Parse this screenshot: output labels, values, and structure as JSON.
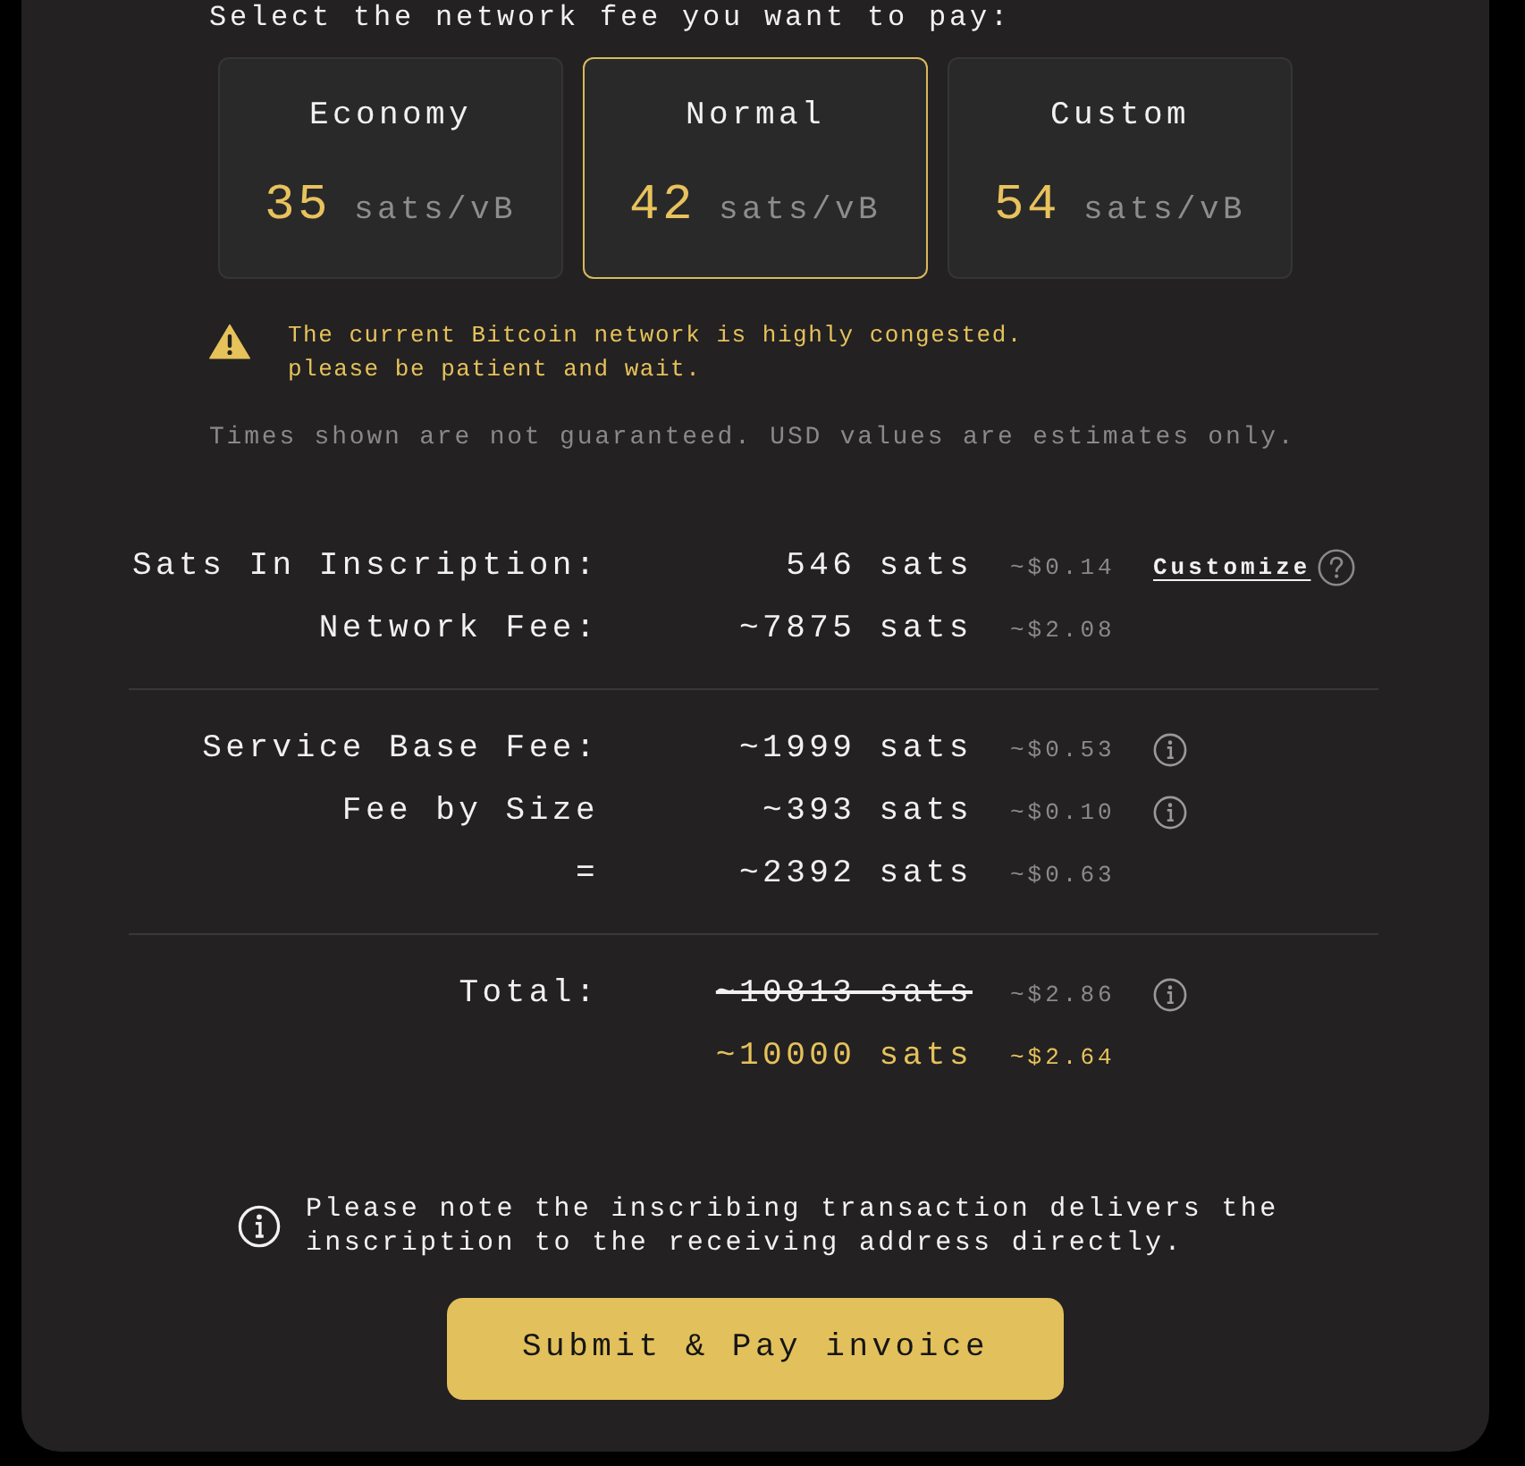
{
  "heading": "Select the network fee you want to pay:",
  "fee_options": [
    {
      "label": "Economy",
      "rate": "35",
      "unit": "sats/vB",
      "selected": false
    },
    {
      "label": "Normal",
      "rate": "42",
      "unit": "sats/vB",
      "selected": true
    },
    {
      "label": "Custom",
      "rate": "54",
      "unit": "sats/vB",
      "selected": false
    }
  ],
  "warning": "The current Bitcoin network is highly congested. please be patient and wait.",
  "disclaimer": "Times shown are not guaranteed. USD values are estimates only.",
  "summary": [
    {
      "rows": [
        {
          "label": "Sats In Inscription:",
          "amount": "546 sats",
          "usd": "~$0.14",
          "struck": false,
          "highlight": false,
          "extra": {
            "kind": "customize",
            "label": "Customize"
          }
        },
        {
          "label": "Network Fee:",
          "amount": "~7875 sats",
          "usd": "~$2.08",
          "struck": false,
          "highlight": false
        }
      ]
    },
    {
      "rows": [
        {
          "label": "Service Base Fee:",
          "amount": "~1999 sats",
          "usd": "~$0.53",
          "struck": false,
          "highlight": false,
          "extra": {
            "kind": "info"
          }
        },
        {
          "label": "Fee by Size",
          "amount": "~393 sats",
          "usd": "~$0.10",
          "struck": false,
          "highlight": false,
          "extra": {
            "kind": "info"
          }
        },
        {
          "label": "=",
          "amount": "~2392 sats",
          "usd": "~$0.63",
          "struck": false,
          "highlight": false
        }
      ]
    },
    {
      "rows": [
        {
          "label": "Total:",
          "amount": "~10813 sats",
          "usd": "~$2.86",
          "struck": true,
          "highlight": false,
          "extra": {
            "kind": "info"
          }
        },
        {
          "amount": "~10000 sats",
          "usd": "~$2.64",
          "struck": false,
          "highlight": true
        }
      ]
    }
  ],
  "note": "Please note the inscribing transaction delivers the inscription to the receiving address directly.",
  "submit_button": "Submit & Pay invoice"
}
